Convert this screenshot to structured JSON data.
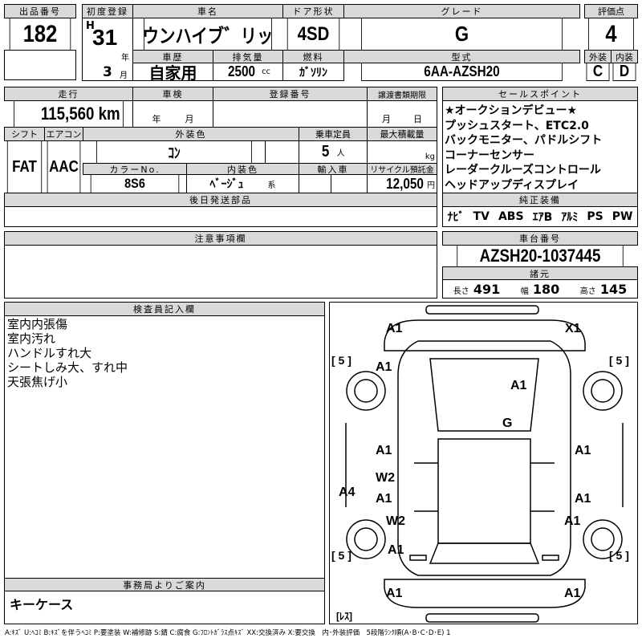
{
  "lot": {
    "label": "出品番号",
    "value": "182"
  },
  "first_reg": {
    "label": "初度登録",
    "era": "H",
    "year": "31",
    "year_unit": "年",
    "month": "3",
    "month_unit": "月"
  },
  "car_name": {
    "label": "車名",
    "value": "クラウンハイブ゛リッド゛"
  },
  "door": {
    "label": "ドア形状",
    "value": "4SD"
  },
  "grade": {
    "label": "グレード",
    "value": "G"
  },
  "score": {
    "label": "評価点",
    "value": "4",
    "ext_label": "外装",
    "int_label": "内装",
    "ext": "C",
    "int": "D"
  },
  "history": {
    "label": "車歴",
    "value": "自家用"
  },
  "displacement": {
    "label": "排気量",
    "value": "2500",
    "unit": "cc"
  },
  "fuel": {
    "label": "燃料",
    "value": "ｶﾞｿﾘﾝ"
  },
  "model": {
    "label": "型式",
    "value": "6AA-AZSH20"
  },
  "mileage": {
    "label": "走行",
    "value": "115,560 km"
  },
  "inspection": {
    "label": "車検",
    "year_unit": "年",
    "month_unit": "月"
  },
  "reg_no": {
    "label": "登録番号"
  },
  "transfer": {
    "label": "譲渡書類期限",
    "month_unit": "月",
    "day_unit": "日"
  },
  "shift": {
    "label": "シフト",
    "value": "FAT"
  },
  "ac": {
    "label": "エアコン",
    "value": "AAC"
  },
  "ext_color": {
    "label": "外装色",
    "value": "ｺﾝ"
  },
  "capacity": {
    "label": "乗車定員",
    "value": "5",
    "unit": "人"
  },
  "max_load": {
    "label": "最大積載量",
    "unit": "kg"
  },
  "color_no": {
    "label": "カラーNo.",
    "value": "8S6"
  },
  "int_color": {
    "label": "内装色",
    "value": "ﾍﾞｰｼﾞｭ",
    "suffix": "系"
  },
  "import": {
    "label": "輸入車"
  },
  "recycle": {
    "label": "リサイクル預託金",
    "value": "12,050",
    "unit": "円"
  },
  "later_parts": {
    "label": "後日発送部品"
  },
  "sales_points": {
    "label": "セールスポイント",
    "items": [
      "★オークションデビュー★",
      "プッシュスタート、ETC2.0",
      "バックモニター、パドルシフト",
      "コーナーセンサー",
      "レーダークルーズコントロール",
      "ヘッドアップディスプレイ"
    ]
  },
  "equipment": {
    "label": "純正装備",
    "items": [
      "ﾅﾋﾞ",
      "TV",
      "ABS",
      "ｴｱB",
      "ｱﾙﾐ",
      "PS",
      "PW"
    ]
  },
  "notes": {
    "label": "注意事項欄"
  },
  "chassis": {
    "label": "車台番号",
    "value": "AZSH20-1037445"
  },
  "specs": {
    "label": "諸元",
    "length_label": "長さ",
    "length": "491",
    "width_label": "幅",
    "width": "180",
    "height_label": "高さ",
    "height": "145"
  },
  "inspector": {
    "label": "検査員記入欄",
    "items": [
      "室内内張傷",
      "室内汚れ",
      "ハンドルすれ大",
      "シートしみ大、すれ中",
      "天張焦げ小"
    ]
  },
  "office": {
    "label": "事務局よりご案内",
    "value": "キーケース"
  },
  "diagram": {
    "marks": [
      "A1",
      "X1",
      "A1",
      "A1",
      "G",
      "A1",
      "A1",
      "W2",
      "A1",
      "A1",
      "A4",
      "W2",
      "A1",
      "A1",
      "A1",
      "A1"
    ],
    "tires": [
      "[ 5 ]",
      "[ 5 ]",
      "[ 5 ]",
      "[ 5 ]"
    ],
    "spare": "[ﾚｽ]"
  },
  "legend": "A:ｷｽﾞ U:ﾍｺﾐ B:ｷｽﾞを伴うﾍｺﾐ P:要塗装 W:補修跡 S:錆 C:腐食 G:ﾌﾛﾝﾄｶﾞﾗｽ点ｷｽﾞ XX:交換済み X:要交換　内･外装評価　5段階ﾗﾝｸ順(A･B･C･D･E) 1"
}
